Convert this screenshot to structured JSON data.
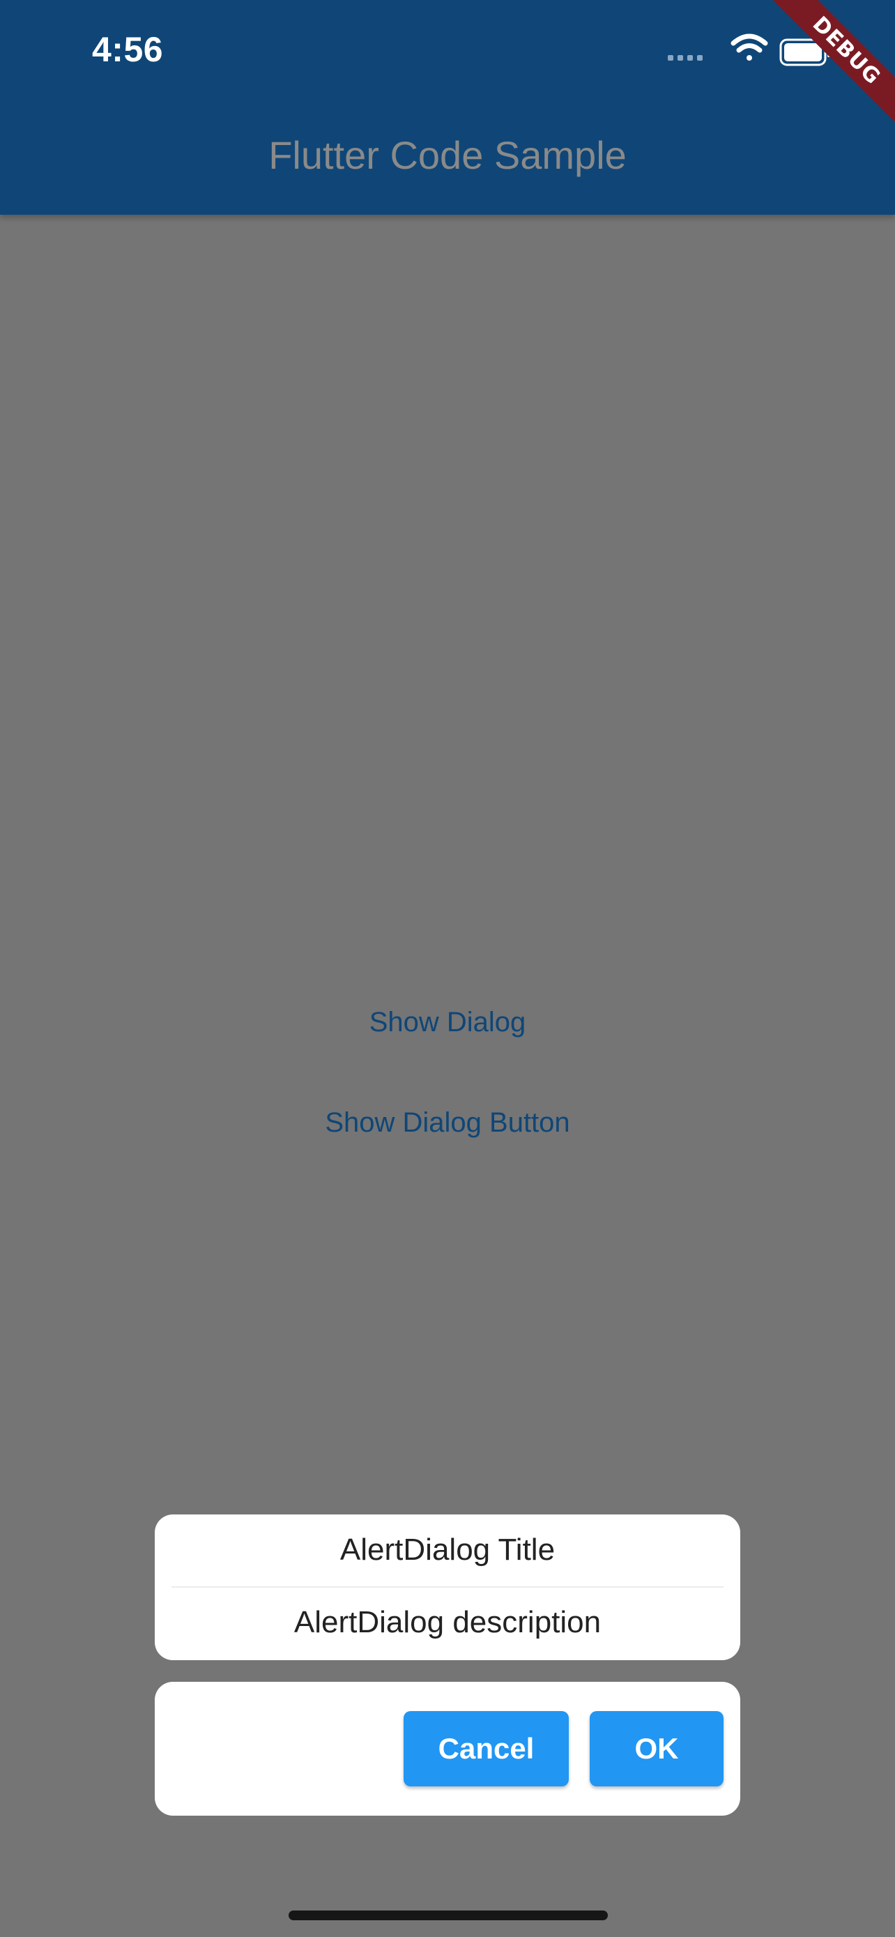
{
  "status_bar": {
    "time": "4:56"
  },
  "appbar": {
    "title": "Flutter Code Sample"
  },
  "debug_banner": {
    "label": "DEBUG"
  },
  "body": {
    "show_dialog_label": "Show Dialog",
    "show_dialog_button_label": "Show Dialog Button"
  },
  "dialog": {
    "title": "AlertDialog Title",
    "description": "AlertDialog description",
    "cancel_label": "Cancel",
    "ok_label": "OK"
  },
  "colors": {
    "appbar": "#0f4677",
    "scrim_background": "#757575",
    "accent_button": "#2196f3",
    "debug_banner": "#7a1b24"
  },
  "icons": [
    "cellular-signal-icon",
    "wifi-icon",
    "battery-icon"
  ]
}
